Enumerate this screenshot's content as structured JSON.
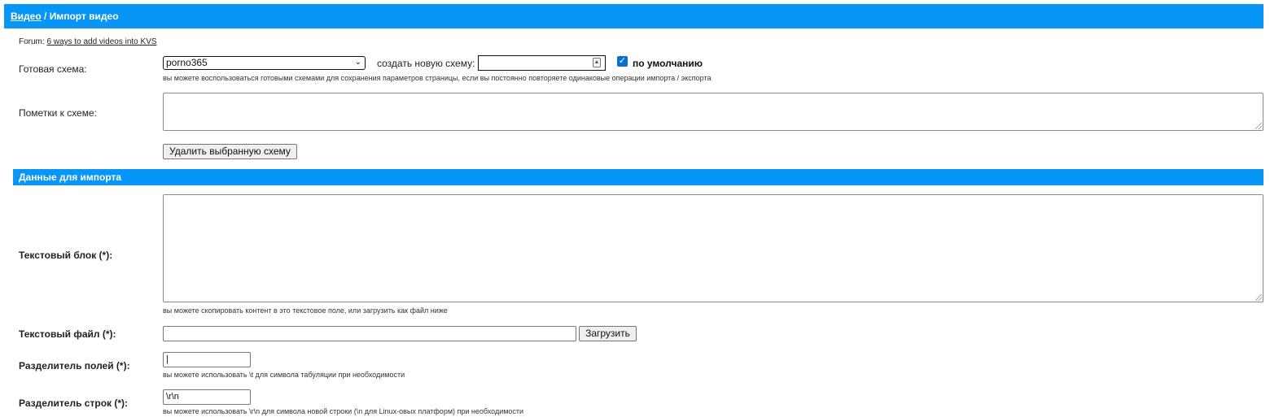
{
  "header": {
    "breadcrumb_link": "Видео",
    "separator": " / ",
    "title": "Импорт видео"
  },
  "forum": {
    "prefix": "Forum: ",
    "link": "6 ways to add videos into KVS"
  },
  "schema": {
    "label": "Готовая схема:",
    "selected": "porno365",
    "create_label": "создать новую схему:",
    "new_name_value": "",
    "default_checked": true,
    "default_label": "по умолчанию",
    "hint": "вы можете воспользоваться готовыми схемами для сохранения параметров страницы, если вы постоянно повторяете одинаковые операции импорта / экспорта",
    "notes_label": "Пометки к схеме:",
    "notes_value": "",
    "delete_button": "Удалить выбранную схему"
  },
  "import_section": {
    "title": "Данные для импорта",
    "text_block_label": "Текстовый блок (*):",
    "text_block_value": "",
    "text_block_hint": "вы можете скопировать контент в это текстовое поле, или загрузить как файл ниже",
    "text_file_label": "Текстовый файл (*):",
    "text_file_value": "",
    "upload_button": "Загрузить",
    "field_sep_label": "Разделитель полей (*):",
    "field_sep_value": "|",
    "field_sep_hint": "вы можете использовать \\t для символа табуляции при необходимости",
    "row_sep_label": "Разделитель строк (*):",
    "row_sep_value": "\\r\\n",
    "row_sep_hint": "вы можете использовать \\r\\n для символа новой строки (\\n для Linux-овых платформ) при необходимости"
  },
  "colors": {
    "header_bg": "#0795f6",
    "checkbox": "#0b6fd0"
  }
}
